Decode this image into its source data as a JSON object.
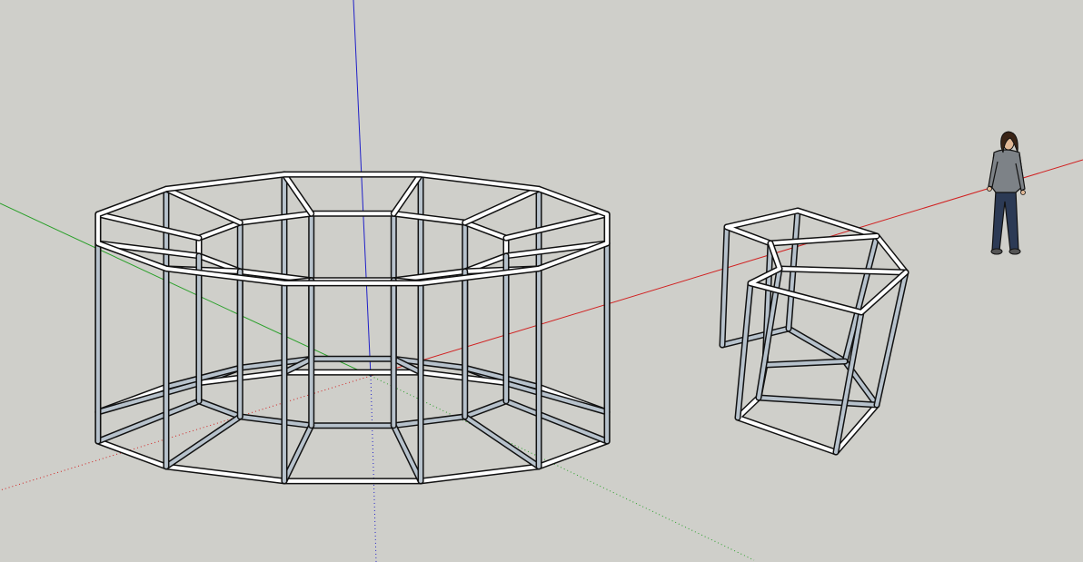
{
  "viewport": {
    "background": "#cfcfca"
  },
  "axes": {
    "red": "#d02020",
    "green": "#2aa02a",
    "blue": "#2020c8"
  },
  "frame_colors": {
    "outline": "#111111",
    "face_light": "#ffffff",
    "face_shade": "#b7c2cc"
  },
  "objects": [
    {
      "name": "large-ring-frame",
      "icon": "steel-frame-model"
    },
    {
      "name": "partial-frame",
      "icon": "steel-frame-model"
    },
    {
      "name": "scale-figure",
      "icon": "person-figure"
    }
  ]
}
